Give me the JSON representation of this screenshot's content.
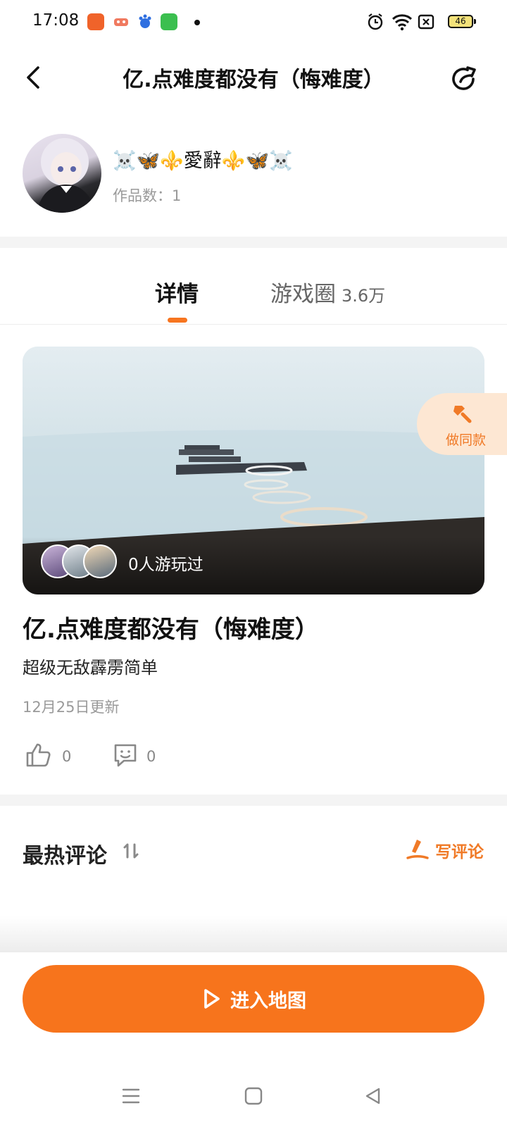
{
  "status_bar": {
    "time": "17:08",
    "battery": "46",
    "icons": [
      "kuaishou-app-icon",
      "game-app-icon",
      "baidu-app-icon",
      "green-app-icon",
      "alarm-icon",
      "wifi-icon",
      "sim-off-icon",
      "battery-icon"
    ]
  },
  "header": {
    "title": "亿.点难度都没有（悔难度）",
    "back_icon": "back-icon",
    "share_icon": "share-icon"
  },
  "author": {
    "name": "☠️🦋⚜️愛辭⚜️🦋☠️",
    "works_label": "作品数：1"
  },
  "tabs": [
    {
      "label": "详情",
      "active": true
    },
    {
      "label": "游戏圈",
      "count": "3.6万",
      "active": false
    }
  ],
  "cover": {
    "played_text": "0人游玩过",
    "make_same_label": "做同款",
    "make_same_icon": "hammer-icon"
  },
  "map": {
    "title": "亿.点难度都没有（悔难度）",
    "description": "超级无敌霹雳简单",
    "updated": "12月25日更新",
    "likes": "0",
    "comments": "0"
  },
  "comments_section": {
    "title": "最热评论",
    "sort_icon": "sort-icon",
    "write_label": "写评论",
    "write_icon": "pen-icon"
  },
  "actions": {
    "enter_label": "进入地图",
    "enter_icon": "play-icon"
  },
  "nav": [
    "menu-icon",
    "home-square-icon",
    "back-triangle-icon"
  ],
  "colors": {
    "accent": "#f7741c",
    "accent_light": "#fde7d3",
    "muted_text": "#9a9a9a"
  }
}
